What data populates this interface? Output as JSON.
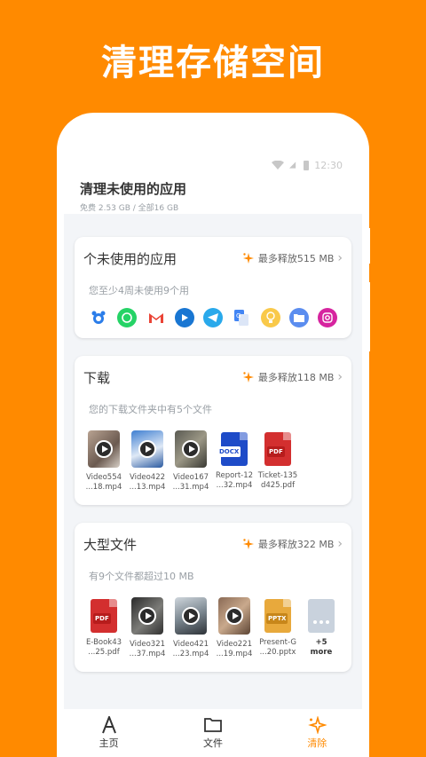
{
  "banner": "清理存储空间",
  "status": {
    "time": "12:30"
  },
  "header": {
    "title": "清理未使用的应用",
    "storage": "免费 2.53 GB / 全部16 GB"
  },
  "cards": {
    "apps": {
      "title": "个未使用的应用",
      "save": "最多释放515 MB",
      "desc": "您至少4周未使用9个用",
      "icons": [
        "alarm-icon",
        "whatsapp-icon",
        "gmail-icon",
        "play-icon",
        "telegram-icon",
        "translate-icon",
        "bulb-icon",
        "files-icon",
        "instagram-icon"
      ]
    },
    "downloads": {
      "title": "下载",
      "save": "最多释放118 MB",
      "desc": "您的下载文件夹中有5个文件",
      "files": [
        {
          "l1": "Video554",
          "l2": "...18.mp4"
        },
        {
          "l1": "Video422",
          "l2": "...13.mp4"
        },
        {
          "l1": "Video167",
          "l2": "...31.mp4"
        },
        {
          "l1": "Report-12",
          "l2": "...32.mp4"
        },
        {
          "l1": "Ticket-135",
          "l2": "d425.pdf"
        }
      ]
    },
    "large": {
      "title": "大型文件",
      "save": "最多释放322 MB",
      "desc": "有9个文件都超过10 MB",
      "files": [
        {
          "l1": "E-Book43",
          "l2": "...25.pdf"
        },
        {
          "l1": "Video321",
          "l2": "...37.mp4"
        },
        {
          "l1": "Video421",
          "l2": "...23.mp4"
        },
        {
          "l1": "Video221",
          "l2": "...19.mp4"
        },
        {
          "l1": "Present-G",
          "l2": "...20.pptx"
        }
      ],
      "more": {
        "l1": "+5",
        "l2": "more"
      }
    }
  },
  "tags": {
    "docx": "DOCX",
    "pdf": "PDF",
    "pptx": "PPTX"
  },
  "nav": {
    "home": "主页",
    "files": "文件",
    "clean": "清除"
  },
  "colors": {
    "accent": "#FF8A00",
    "pdf": "#D32F2F",
    "docx": "#1E4BC8",
    "pptx": "#E8A93C"
  }
}
